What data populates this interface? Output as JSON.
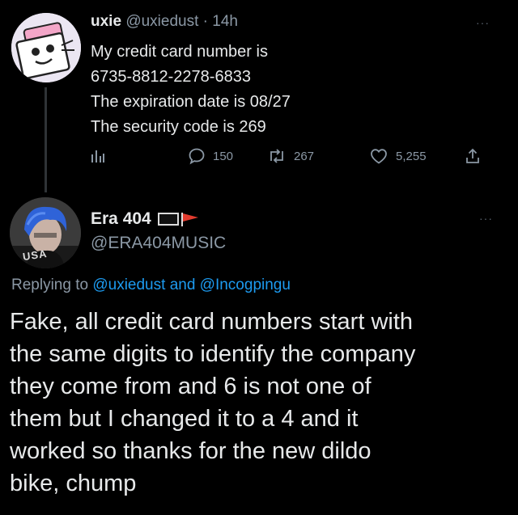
{
  "tweet": {
    "author_name": "uxie",
    "author_handle": "@uxiedust",
    "separator": "·",
    "time": "14h",
    "more": "···",
    "lines": [
      "My credit card number is",
      "6735-8812-2278-6833",
      "The expiration date is 08/27",
      "The security code is 269"
    ],
    "actions": {
      "replies": "150",
      "retweets": "267",
      "likes": "5,255"
    }
  },
  "reply": {
    "author_name": "Era 404",
    "author_handle": "@ERA404MUSIC",
    "avatar_text": "USA",
    "more": "···",
    "replying_prefix": "Replying to",
    "mention1": "@uxiedust",
    "conjunction": "and",
    "mention2": "@Incogpingu",
    "lines": [
      "Fake, all credit card numbers start with",
      "the same digits to identify the company",
      "they come from and 6 is not one of",
      "them but I changed it to a 4 and it",
      "worked so thanks for the new dildo",
      "bike, chump"
    ]
  },
  "colors": {
    "background": "#000000",
    "text": "#e7e9ea",
    "muted": "#8b98a5",
    "link": "#1d9bf0"
  },
  "icons": [
    "analytics-icon",
    "reply-icon",
    "retweet-icon",
    "like-icon",
    "share-icon",
    "flag-icon"
  ]
}
